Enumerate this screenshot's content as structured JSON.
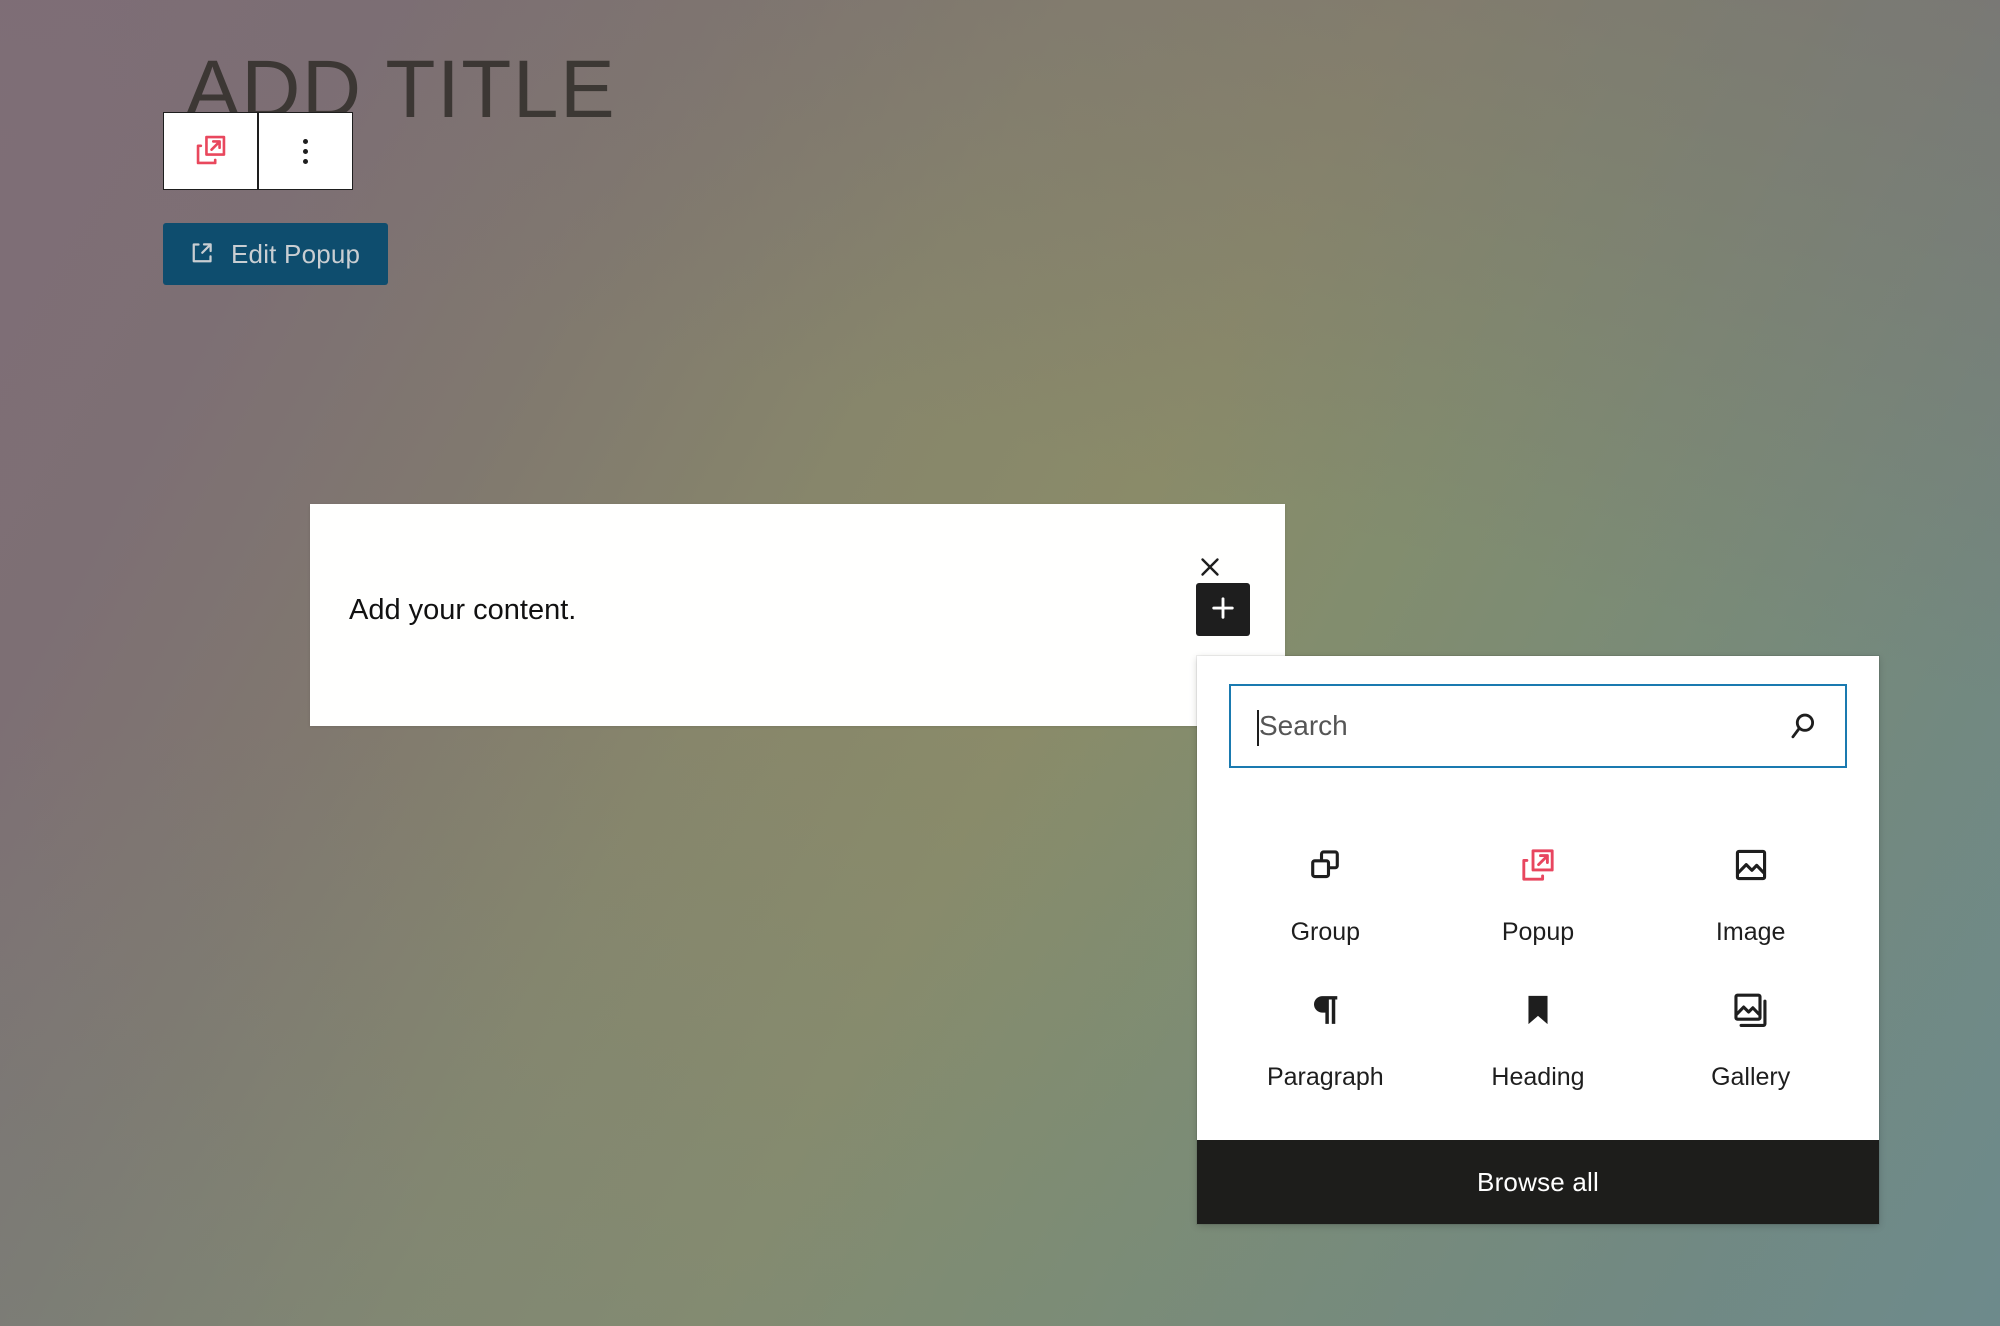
{
  "editor": {
    "title_placeholder": "ADD TITLE",
    "block_toolbar": {
      "popup_block_button": "popup-block-icon",
      "options_button": "three-dots-vertical-icon"
    },
    "edit_popup_button": {
      "label": "Edit Popup",
      "icon": "external-link-icon",
      "background_color": "#0e4d6e",
      "text_color": "#c9ced2"
    },
    "content_block": {
      "text": "Add your content.",
      "background_color": "#ffffff"
    },
    "close_control": {
      "icon": "close-x-icon",
      "label": "×"
    },
    "add_block_control": {
      "icon": "plus-icon",
      "label": "+",
      "background_color": "#1e1e1e"
    }
  },
  "inserter": {
    "search": {
      "placeholder": "Search",
      "value": "",
      "icon": "magnifier-icon",
      "focus_border_color": "#1a7ab0"
    },
    "blocks": [
      {
        "label": "Group",
        "icon": "group-blocks-icon",
        "accent": "#1e1e1e"
      },
      {
        "label": "Popup",
        "icon": "popup-block-icon",
        "accent": "#e8465f"
      },
      {
        "label": "Image",
        "icon": "image-icon",
        "accent": "#1e1e1e"
      },
      {
        "label": "Paragraph",
        "icon": "pilcrow-icon",
        "accent": "#1e1e1e"
      },
      {
        "label": "Heading",
        "icon": "bookmark-icon",
        "accent": "#1e1e1e"
      },
      {
        "label": "Gallery",
        "icon": "gallery-icon",
        "accent": "#1e1e1e"
      }
    ],
    "browse_all_label": "Browse all",
    "browse_all_background": "#1d1d1b"
  },
  "background": {
    "top_left_color": "#7f6e77",
    "middle_color": "#8a8b69",
    "bottom_right_color": "#6d8a8c"
  }
}
